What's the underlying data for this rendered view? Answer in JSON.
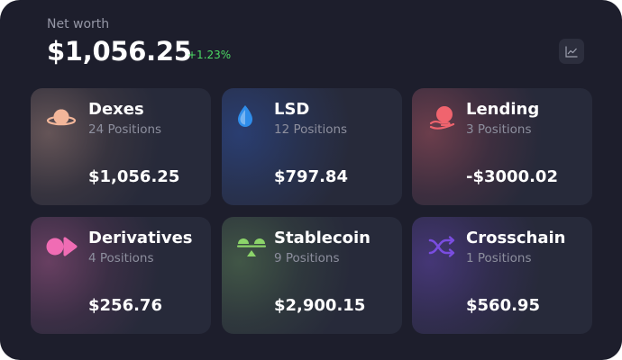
{
  "header": {
    "label": "Net worth",
    "value": "$1,056.25",
    "change": "+1.23%",
    "chart_button_icon": "line-chart-icon"
  },
  "cards": [
    {
      "title": "Dexes",
      "positions": "24 Positions",
      "amount": "$1,056.25",
      "icon": "dex-orb-icon",
      "accent": "#f3b69a"
    },
    {
      "title": "LSD",
      "positions": "12 Positions",
      "amount": "$797.84",
      "icon": "water-drop-icon",
      "accent": "#2f8dea"
    },
    {
      "title": "Lending",
      "positions": "3 Positions",
      "amount": "-$3000.02",
      "icon": "coin-hand-icon",
      "accent": "#f0646e"
    },
    {
      "title": "Derivatives",
      "positions": "4 Positions",
      "amount": "$256.76",
      "icon": "derivatives-icon",
      "accent": "#f06cb4"
    },
    {
      "title": "Stablecoin",
      "positions": "9 Positions",
      "amount": "$2,900.15",
      "icon": "stablecoin-scale-icon",
      "accent": "#8cd46a"
    },
    {
      "title": "Crosschain",
      "positions": "1 Positions",
      "amount": "$560.95",
      "icon": "crosschain-arrows-icon",
      "accent": "#7a4de0"
    }
  ],
  "colors": {
    "background": "#1d1e2c",
    "card": "#272a3a",
    "positive": "#4cd964",
    "muted_text": "#8d8f9e"
  }
}
